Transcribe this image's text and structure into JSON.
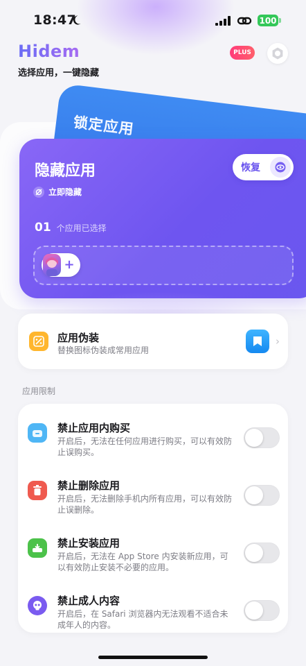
{
  "status_bar": {
    "time": "18:47",
    "battery": "100"
  },
  "header": {
    "brand": "Hidem",
    "subtitle": "选择应用，一键隐藏",
    "plus_badge": "PLUS"
  },
  "lock_card": {
    "title": "锁定应用"
  },
  "hide_card": {
    "title": "隐藏应用",
    "hide_now_label": "立即隐藏",
    "restore_label": "恢复",
    "selected_count": "01",
    "selected_label": "个应用已选择",
    "add_symbol": "+"
  },
  "disguise": {
    "title": "应用伪装",
    "description": "替换图标伪装成常用应用"
  },
  "restrictions": {
    "section_label": "应用限制",
    "items": [
      {
        "title": "禁止应用内购买",
        "description": "开启后，无法在任何应用进行购买，可以有效防止误购买。",
        "enabled": false,
        "icon": "shopping-bag-icon",
        "color": "#4fb6f5"
      },
      {
        "title": "禁止删除应用",
        "description": "开启后，无法删除手机内所有应用，可以有效防止误删除。",
        "enabled": false,
        "icon": "trash-icon",
        "color": "#ef5a4f"
      },
      {
        "title": "禁止安装应用",
        "description": "开启后，无法在 App Store 内安装新应用，可以有效防止安装不必要的应用。",
        "enabled": false,
        "icon": "install-tray-icon",
        "color": "#4cc24a"
      },
      {
        "title": "禁止成人内容",
        "description": "开启后，在 Safari 浏览器内无法观看不适合未成年人的内容。",
        "enabled": false,
        "icon": "skull-icon",
        "color": "#7a5bf0"
      }
    ]
  }
}
